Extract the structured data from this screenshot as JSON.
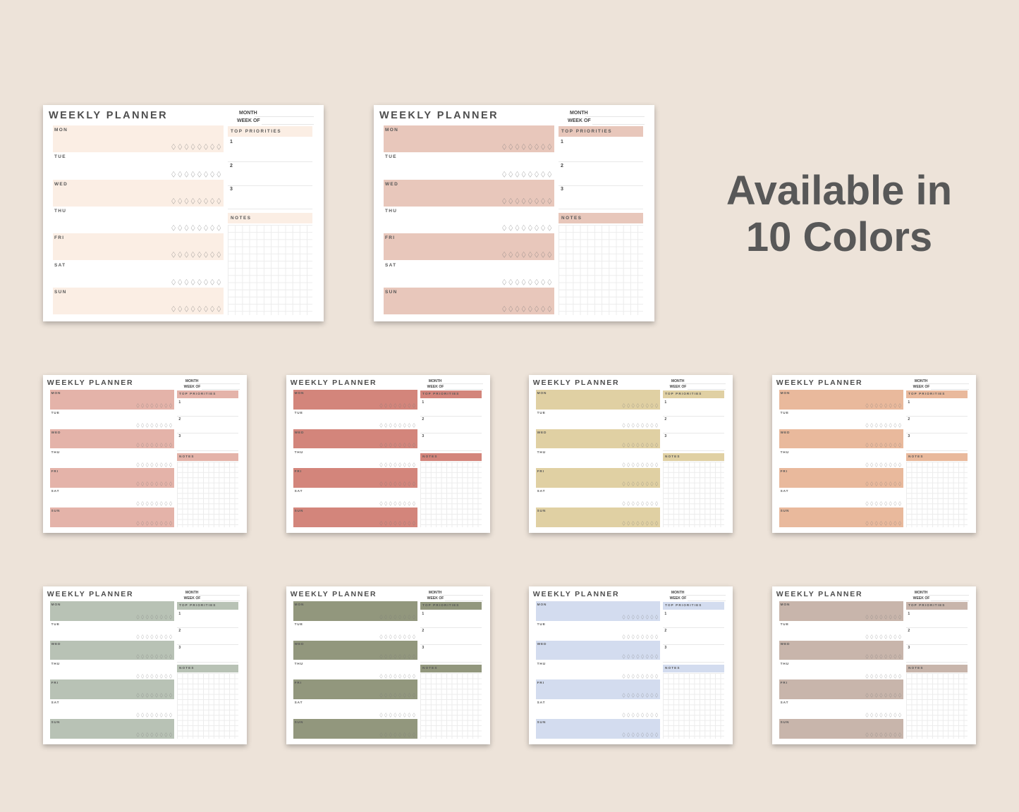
{
  "headline": {
    "line1": "Available in",
    "line2": "10 Colors"
  },
  "planner_template": {
    "title": "WEEKLY PLANNER",
    "month_label": "MONTH",
    "week_label": "WEEK OF",
    "priorities_label": "TOP PRIORITIES",
    "notes_label": "NOTES",
    "priority_numbers": [
      "1",
      "2",
      "3"
    ],
    "days": [
      "MON",
      "TUE",
      "WED",
      "THU",
      "FRI",
      "SAT",
      "SUN"
    ],
    "water_icon": "water-drop-icon",
    "drops_per_day": 8
  },
  "planners": [
    {
      "color": "#fbeee4",
      "style": "alternate"
    },
    {
      "color": "#e8c7bb",
      "style": "alternate"
    },
    {
      "color": "#e4b3a9",
      "style": "alternate"
    },
    {
      "color": "#d3857b",
      "style": "alternate"
    },
    {
      "color": "#e0d0a3",
      "style": "alternate"
    },
    {
      "color": "#e9b99c",
      "style": "alternate"
    },
    {
      "color": "#b8c2b5",
      "style": "alternate"
    },
    {
      "color": "#92977d",
      "style": "alternate"
    },
    {
      "color": "#d3dcef",
      "style": "alternate"
    },
    {
      "color": "#c8b5ab",
      "style": "alternate"
    }
  ]
}
